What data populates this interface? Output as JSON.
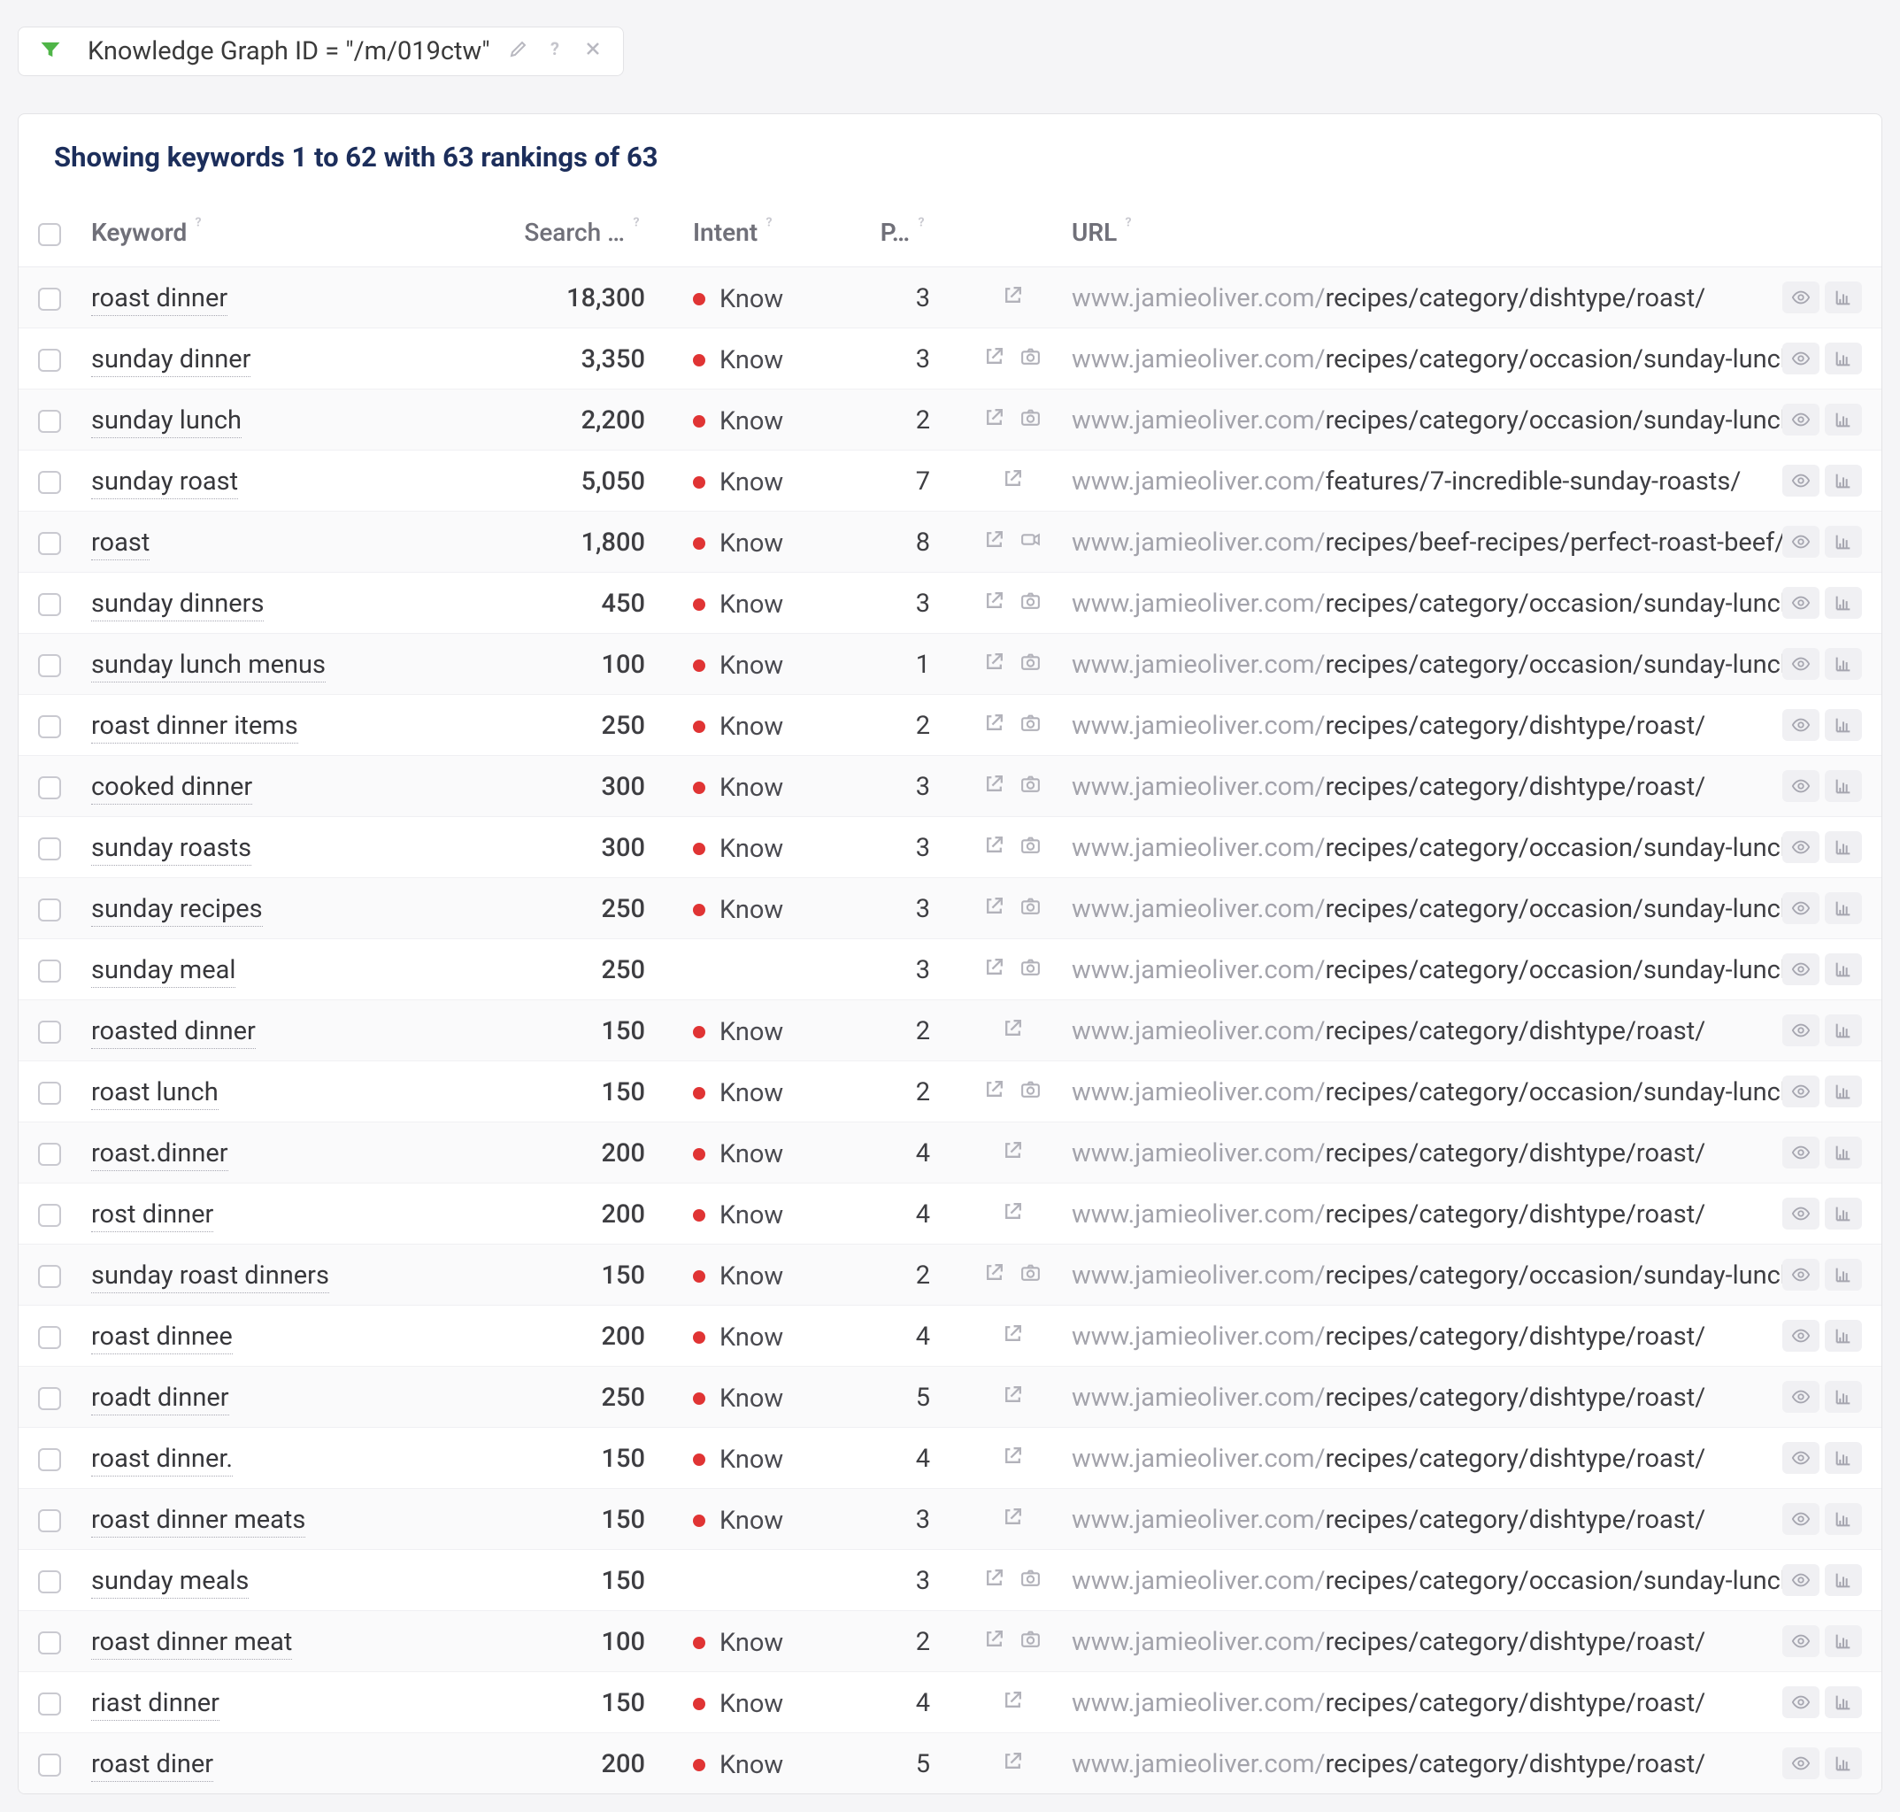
{
  "filter": {
    "chip": "Knowledge Graph ID = \"/m/019ctw\""
  },
  "caption": "Showing keywords 1 to 62 with 63 rankings of 63",
  "columns": {
    "keyword": "Keyword",
    "search": "Search …",
    "intent": "Intent",
    "position": "P…",
    "url": "URL"
  },
  "rows": [
    {
      "kw": "roast dinner",
      "sv": "18,300",
      "intent": "Know",
      "pos": "3",
      "icons": [
        "ext"
      ],
      "dom": "www.jamieoliver.com/",
      "path": "recipes/category/dishtype/roast/"
    },
    {
      "kw": "sunday dinner",
      "sv": "3,350",
      "intent": "Know",
      "pos": "3",
      "icons": [
        "ext",
        "cam"
      ],
      "dom": "www.jamieoliver.com/",
      "path": "recipes/category/occasion/sunday-lunch/"
    },
    {
      "kw": "sunday lunch",
      "sv": "2,200",
      "intent": "Know",
      "pos": "2",
      "icons": [
        "ext",
        "cam"
      ],
      "dom": "www.jamieoliver.com/",
      "path": "recipes/category/occasion/sunday-lunch/"
    },
    {
      "kw": "sunday roast",
      "sv": "5,050",
      "intent": "Know",
      "pos": "7",
      "icons": [
        "ext"
      ],
      "dom": "www.jamieoliver.com/",
      "path": "features/7-incredible-sunday-roasts/"
    },
    {
      "kw": "roast",
      "sv": "1,800",
      "intent": "Know",
      "pos": "8",
      "icons": [
        "ext",
        "vid"
      ],
      "dom": "www.jamieoliver.com/",
      "path": "recipes/beef-recipes/perfect-roast-beef/"
    },
    {
      "kw": "sunday dinners",
      "sv": "450",
      "intent": "Know",
      "pos": "3",
      "icons": [
        "ext",
        "cam"
      ],
      "dom": "www.jamieoliver.com/",
      "path": "recipes/category/occasion/sunday-lunch/"
    },
    {
      "kw": "sunday lunch menus",
      "sv": "100",
      "intent": "Know",
      "pos": "1",
      "icons": [
        "ext",
        "cam"
      ],
      "dom": "www.jamieoliver.com/",
      "path": "recipes/category/occasion/sunday-lunch/"
    },
    {
      "kw": "roast dinner items",
      "sv": "250",
      "intent": "Know",
      "pos": "2",
      "icons": [
        "ext",
        "cam"
      ],
      "dom": "www.jamieoliver.com/",
      "path": "recipes/category/dishtype/roast/"
    },
    {
      "kw": "cooked dinner",
      "sv": "300",
      "intent": "Know",
      "pos": "3",
      "icons": [
        "ext",
        "cam"
      ],
      "dom": "www.jamieoliver.com/",
      "path": "recipes/category/dishtype/roast/"
    },
    {
      "kw": "sunday roasts",
      "sv": "300",
      "intent": "Know",
      "pos": "3",
      "icons": [
        "ext",
        "cam"
      ],
      "dom": "www.jamieoliver.com/",
      "path": "recipes/category/occasion/sunday-lunch/"
    },
    {
      "kw": "sunday recipes",
      "sv": "250",
      "intent": "Know",
      "pos": "3",
      "icons": [
        "ext",
        "cam"
      ],
      "dom": "www.jamieoliver.com/",
      "path": "recipes/category/occasion/sunday-lunch/"
    },
    {
      "kw": "sunday meal",
      "sv": "250",
      "intent": "",
      "pos": "3",
      "icons": [
        "ext",
        "cam"
      ],
      "dom": "www.jamieoliver.com/",
      "path": "recipes/category/occasion/sunday-lunch/"
    },
    {
      "kw": "roasted dinner",
      "sv": "150",
      "intent": "Know",
      "pos": "2",
      "icons": [
        "ext"
      ],
      "dom": "www.jamieoliver.com/",
      "path": "recipes/category/dishtype/roast/"
    },
    {
      "kw": "roast lunch",
      "sv": "150",
      "intent": "Know",
      "pos": "2",
      "icons": [
        "ext",
        "cam"
      ],
      "dom": "www.jamieoliver.com/",
      "path": "recipes/category/occasion/sunday-lunch/"
    },
    {
      "kw": "roast.dinner",
      "sv": "200",
      "intent": "Know",
      "pos": "4",
      "icons": [
        "ext"
      ],
      "dom": "www.jamieoliver.com/",
      "path": "recipes/category/dishtype/roast/"
    },
    {
      "kw": "rost dinner",
      "sv": "200",
      "intent": "Know",
      "pos": "4",
      "icons": [
        "ext"
      ],
      "dom": "www.jamieoliver.com/",
      "path": "recipes/category/dishtype/roast/"
    },
    {
      "kw": "sunday roast dinners",
      "sv": "150",
      "intent": "Know",
      "pos": "2",
      "icons": [
        "ext",
        "cam"
      ],
      "dom": "www.jamieoliver.com/",
      "path": "recipes/category/occasion/sunday-lunch/"
    },
    {
      "kw": "roast dinnee",
      "sv": "200",
      "intent": "Know",
      "pos": "4",
      "icons": [
        "ext"
      ],
      "dom": "www.jamieoliver.com/",
      "path": "recipes/category/dishtype/roast/"
    },
    {
      "kw": "roadt dinner",
      "sv": "250",
      "intent": "Know",
      "pos": "5",
      "icons": [
        "ext"
      ],
      "dom": "www.jamieoliver.com/",
      "path": "recipes/category/dishtype/roast/"
    },
    {
      "kw": "roast dinner.",
      "sv": "150",
      "intent": "Know",
      "pos": "4",
      "icons": [
        "ext"
      ],
      "dom": "www.jamieoliver.com/",
      "path": "recipes/category/dishtype/roast/"
    },
    {
      "kw": "roast dinner meats",
      "sv": "150",
      "intent": "Know",
      "pos": "3",
      "icons": [
        "ext"
      ],
      "dom": "www.jamieoliver.com/",
      "path": "recipes/category/dishtype/roast/"
    },
    {
      "kw": "sunday meals",
      "sv": "150",
      "intent": "",
      "pos": "3",
      "icons": [
        "ext",
        "cam"
      ],
      "dom": "www.jamieoliver.com/",
      "path": "recipes/category/occasion/sunday-lunch/"
    },
    {
      "kw": "roast dinner meat",
      "sv": "100",
      "intent": "Know",
      "pos": "2",
      "icons": [
        "ext",
        "cam"
      ],
      "dom": "www.jamieoliver.com/",
      "path": "recipes/category/dishtype/roast/"
    },
    {
      "kw": "riast dinner",
      "sv": "150",
      "intent": "Know",
      "pos": "4",
      "icons": [
        "ext"
      ],
      "dom": "www.jamieoliver.com/",
      "path": "recipes/category/dishtype/roast/"
    },
    {
      "kw": "roast diner",
      "sv": "200",
      "intent": "Know",
      "pos": "5",
      "icons": [
        "ext"
      ],
      "dom": "www.jamieoliver.com/",
      "path": "recipes/category/dishtype/roast/"
    }
  ]
}
